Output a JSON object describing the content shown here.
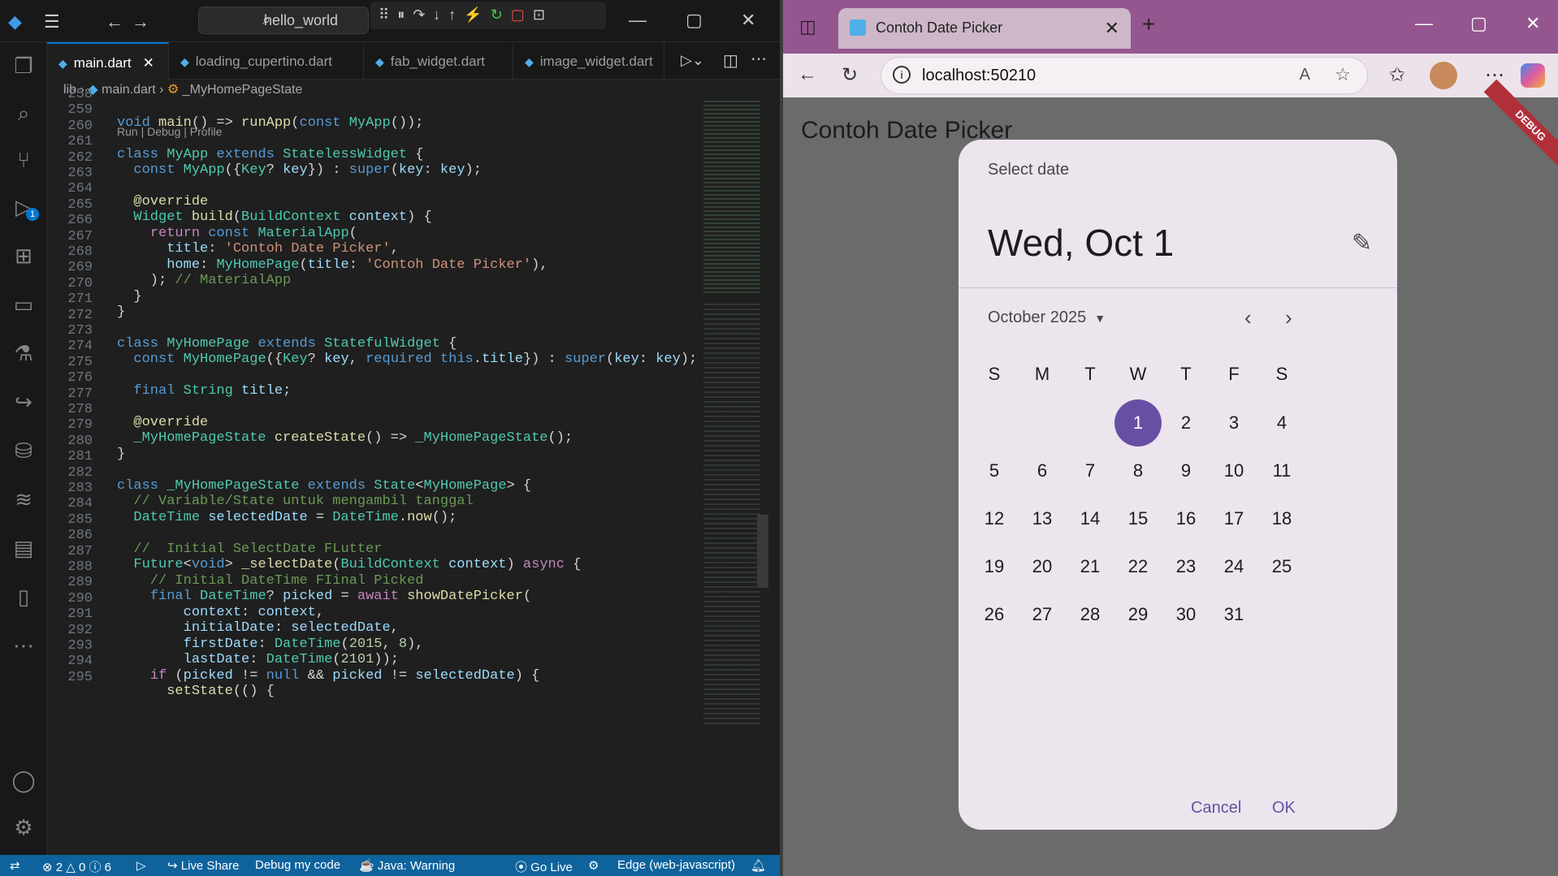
{
  "vscode": {
    "search": "hello_world",
    "tabs": [
      "main.dart",
      "loading_cupertino.dart",
      "fab_widget.dart",
      "image_widget.dart"
    ],
    "breadcrumb": [
      "lib",
      "main.dart",
      "_MyHomePageState"
    ],
    "codelens": "Run | Debug | Profile",
    "lines": [
      "258",
      "259",
      "260",
      "261",
      "262",
      "263",
      "264",
      "265",
      "266",
      "267",
      "268",
      "269",
      "270",
      "271",
      "272",
      "273",
      "274",
      "275",
      "276",
      "277",
      "278",
      "279",
      "280",
      "281",
      "282",
      "283",
      "284",
      "285",
      "286",
      "287",
      "288",
      "289",
      "290",
      "291",
      "292",
      "293",
      "294",
      "295"
    ],
    "status": {
      "errors": "2",
      "warnings": "0",
      "infos": "6",
      "live_share": "Live Share",
      "debug": "Debug my code",
      "java": "Java: Warning",
      "go_live": "Go Live",
      "edge": "Edge (web-javascript)"
    },
    "run_badge": "1"
  },
  "browser": {
    "tab_title": "Contoh Date Picker",
    "url": "localhost:50210",
    "app_title": "Contoh Date Picker",
    "debug": "DEBUG",
    "dialog": {
      "label": "Select date",
      "header": "Wed, Oct 1",
      "month": "October 2025",
      "weekdays": [
        "S",
        "M",
        "T",
        "W",
        "T",
        "F",
        "S"
      ],
      "days": [
        "1",
        "2",
        "3",
        "4",
        "5",
        "6",
        "7",
        "8",
        "9",
        "10",
        "11",
        "12",
        "13",
        "14",
        "15",
        "16",
        "17",
        "18",
        "19",
        "20",
        "21",
        "22",
        "23",
        "24",
        "25",
        "26",
        "27",
        "28",
        "29",
        "30",
        "31"
      ],
      "selected": "1",
      "cancel": "Cancel",
      "ok": "OK"
    }
  }
}
